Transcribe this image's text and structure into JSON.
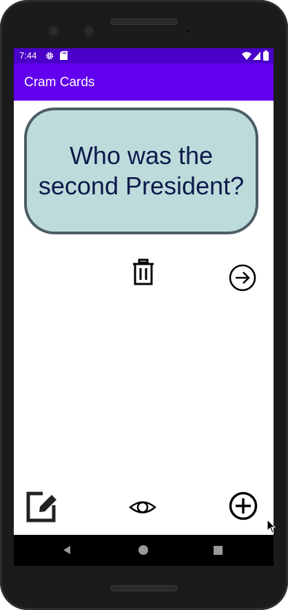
{
  "status_bar": {
    "time": "7:44",
    "icons": [
      "settings-icon",
      "sd-card-icon",
      "wifi-icon",
      "signal-icon",
      "battery-icon"
    ]
  },
  "app_bar": {
    "title": "Cram Cards"
  },
  "card": {
    "question": "Who was the second President?"
  },
  "actions": {
    "delete": "trash-icon",
    "next": "arrow-right-circle-icon",
    "edit": "edit-icon",
    "reveal": "eye-icon",
    "add": "add-circle-icon"
  },
  "nav_bar": {
    "buttons": [
      "back-icon",
      "home-icon",
      "recents-icon"
    ]
  },
  "colors": {
    "status_bar": "#4a00c8",
    "app_bar": "#6200ee",
    "card_fill": "#bddbdb",
    "card_border": "#4c5d66",
    "question_text": "#0d1a4a"
  }
}
